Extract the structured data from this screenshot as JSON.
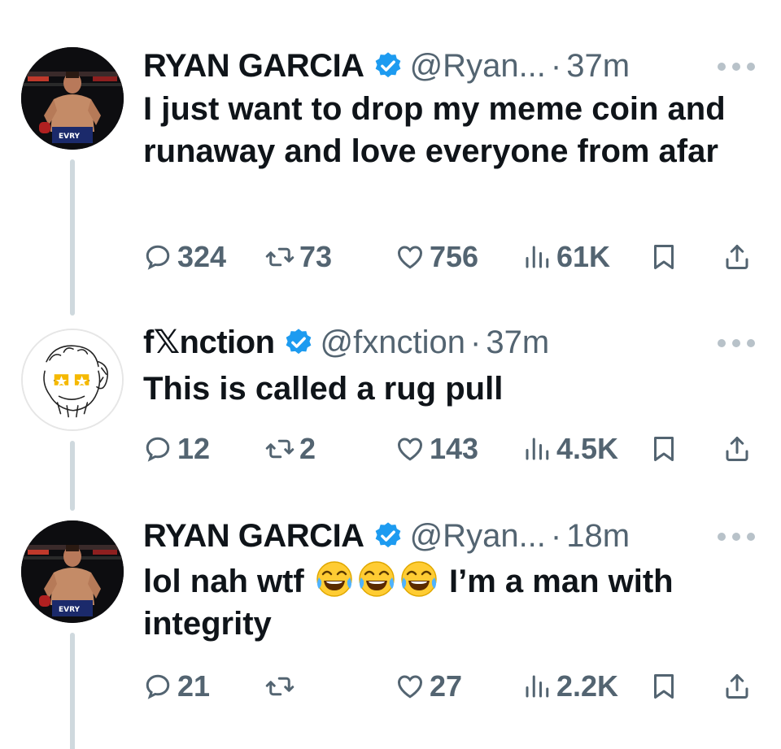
{
  "tweets": [
    {
      "name": "RYAN GARCIA",
      "handle": "@Ryan...",
      "dot": "·",
      "time": "37m",
      "text": "I just want to drop my meme coin and runaway and love everyone from afar",
      "replies": "324",
      "retweets": "73",
      "likes": "756",
      "views": "61K",
      "avatar_icon": "boxer-photo-avatar"
    },
    {
      "name": "f𝕏nction",
      "handle": "@fxnction",
      "dot": "·",
      "time": "37m",
      "text": "This is called a rug pull",
      "replies": "12",
      "retweets": "2",
      "likes": "143",
      "views": "4.5K",
      "avatar_icon": "sketch-face-avatar"
    },
    {
      "name": "RYAN GARCIA",
      "handle": "@Ryan...",
      "dot": "·",
      "time": "18m",
      "text_before": "lol nah wtf ",
      "emojis": [
        "😂",
        "😂",
        "😂"
      ],
      "text_after": " I’m a man with integrity",
      "replies": "21",
      "retweets": "",
      "likes": "27",
      "views": "2.2K",
      "avatar_icon": "boxer-photo-avatar"
    }
  ],
  "colors": {
    "text": "#0f1419",
    "secondary": "#536471",
    "verified": "#1d9bf0",
    "thread_line": "#cfd9de"
  },
  "icons": [
    "reply-icon",
    "retweet-icon",
    "like-icon",
    "views-icon",
    "bookmark-icon",
    "share-icon",
    "verified-badge-icon",
    "more-options-icon"
  ]
}
